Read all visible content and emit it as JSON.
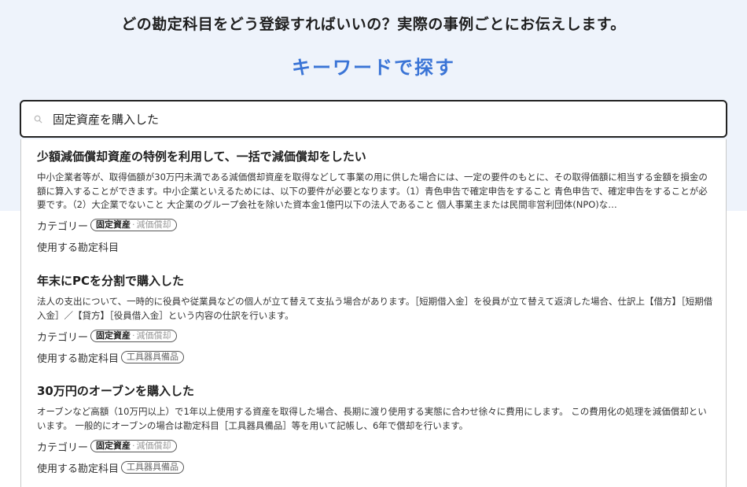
{
  "header": {
    "headline": "どの勘定科目をどう登録すればいいの？実際の事例ごとにお伝えします。",
    "section_title": "キーワードで探す"
  },
  "search": {
    "value": "固定資産を購入した",
    "icon": "search-icon"
  },
  "labels": {
    "category": "カテゴリー",
    "account": "使用する勘定科目"
  },
  "results": [
    {
      "title": "少額減価償却資産の特例を利用して、一括で減価償却をしたい",
      "description": "中小企業者等が、取得価額が30万円未満である減価償却資産を取得などして事業の用に供した場合には、一定の要件のもとに、その取得価額に相当する金額を損金の額に算入することができます。中小企業といえるためには、以下の要件が必要となります。（1）青色申告で確定申告をすること 青色申告で、確定申告をすることが必要です。（2）大企業でないこと 大企業のグループ会社を除いた資本金1億円以下の法人であること 個人事業主または民間非営利団体(NPO)な…",
      "category_main": "固定資産",
      "category_sub": "減価償却",
      "account": ""
    },
    {
      "title": "年末にPCを分割で購入した",
      "description": "法人の支出について、一時的に役員や従業員などの個人が立て替えて支払う場合があります。［短期借入金］を役員が立て替えて返済した場合、仕訳上【借方】［短期借入金］／【貸方】［役員借入金］という内容の仕訳を行います。",
      "category_main": "固定資産",
      "category_sub": "減価償却",
      "account": "工具器具備品"
    },
    {
      "title": "30万円のオーブンを購入した",
      "description": "オーブンなど高額（10万円以上）で1年以上使用する資産を取得した場合、長期に渡り使用する実態に合わせ徐々に費用にします。 この費用化の処理を減価償却といいます。 一般的にオーブンの場合は勘定科目［工具器具備品］等を用いて記帳し、6年で償却を行います。",
      "category_main": "固定資産",
      "category_sub": "減価償却",
      "account": "工具器具備品"
    }
  ]
}
